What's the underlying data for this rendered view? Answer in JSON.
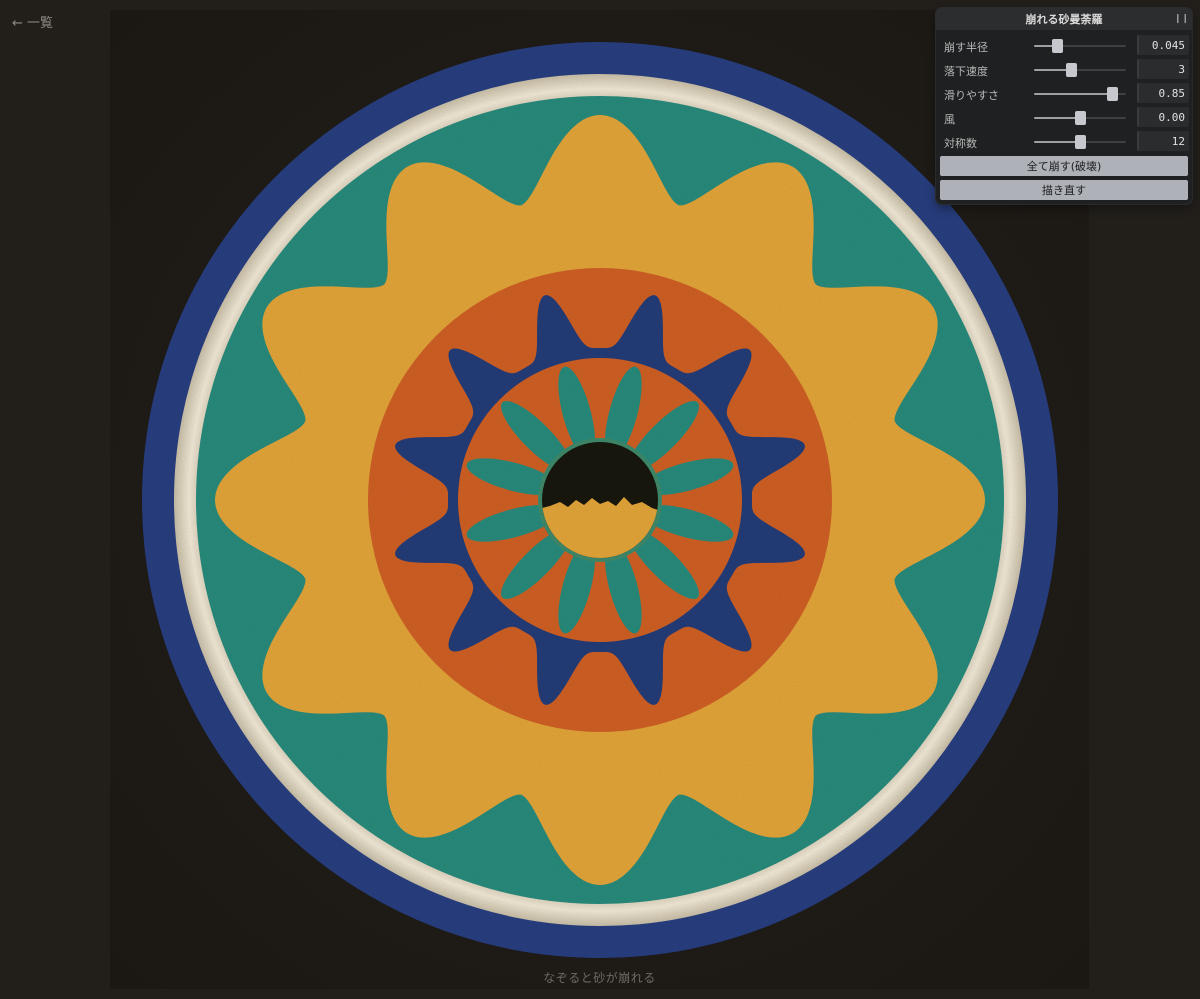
{
  "nav": {
    "back_label": "← 一覧"
  },
  "panel": {
    "title": "崩れる砂曼荼羅",
    "collapse_icon": "pause-icon",
    "params": [
      {
        "label": "崩す半径",
        "value": "0.045",
        "fraction": 0.25
      },
      {
        "label": "落下速度",
        "value": "3",
        "fraction": 0.4
      },
      {
        "label": "滑りやすさ",
        "value": "0.85",
        "fraction": 0.85
      },
      {
        "label": "風",
        "value": "0.00",
        "fraction": 0.5
      },
      {
        "label": "対称数",
        "value": "12",
        "fraction": 0.5
      }
    ],
    "buttons": {
      "collapse_all": "全て崩す(破壊)",
      "redraw": "描き直す"
    }
  },
  "hint": "なぞると砂が崩れる",
  "colors": {
    "background": "#221f1b",
    "blue": "#2b3f80",
    "cream": "#ece3cf",
    "teal": "#2a8b7c",
    "yellow": "#e3a53b",
    "orange": "#cf6128",
    "navy": "#283c78",
    "hole": "#1c1a16"
  }
}
